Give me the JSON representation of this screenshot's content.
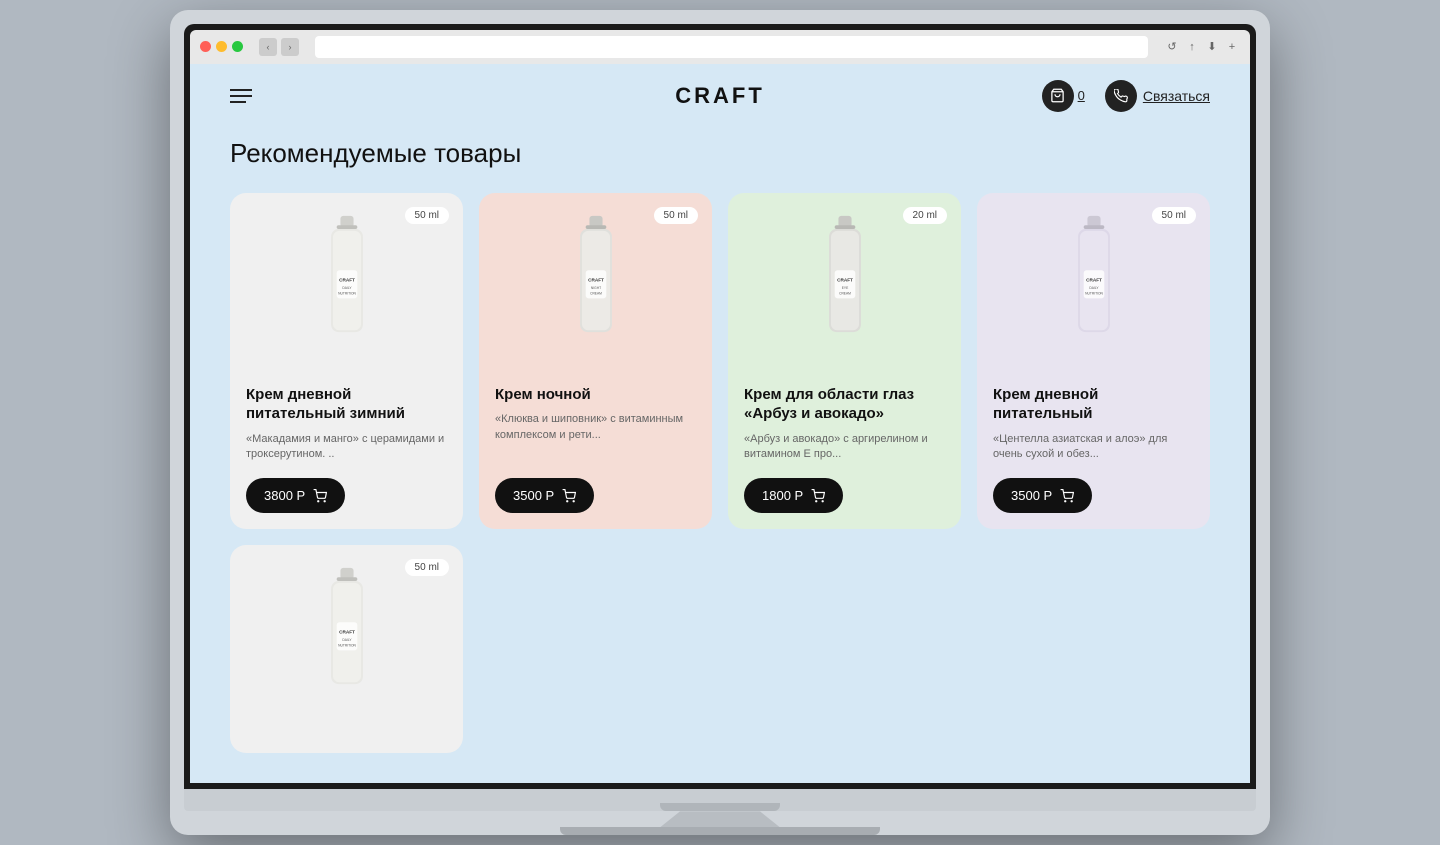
{
  "browser": {
    "nav_back": "‹",
    "nav_forward": "›",
    "reload_icon": "↺",
    "share_icon": "↑",
    "download_icon": "⬇",
    "new_tab_icon": "+"
  },
  "site": {
    "logo": "CRAFT",
    "menu_icon": "menu",
    "cart_count": "0",
    "contact_label": "Связаться",
    "page_title": "Рекомендуемые товары"
  },
  "products": [
    {
      "id": "p1",
      "volume": "50 ml",
      "name": "Крем дневной питательный зимний",
      "desc": "«Макадамия и манго» с церамидами и троксерутином. ..",
      "price": "3800 Р",
      "bg": "white",
      "craft_label": "CRAFT"
    },
    {
      "id": "p2",
      "volume": "50 ml",
      "name": "Крем ночной",
      "desc": "«Клюква и шиповник» с витаминным комплексом и рети...",
      "price": "3500 Р",
      "bg": "pink",
      "craft_label": "CRAFT"
    },
    {
      "id": "p3",
      "volume": "20 ml",
      "name": "Крем для области глаз «Арбуз и авокадо»",
      "desc": "«Арбуз и авокадо» с аргирелином и витамином Е про...",
      "price": "1800 Р",
      "bg": "green",
      "craft_label": "CRAFT"
    },
    {
      "id": "p4",
      "volume": "50 ml",
      "name": "Крем дневной питательный",
      "desc": "«Центелла азиатская и алоэ» для очень сухой и обез...",
      "price": "3500 Р",
      "bg": "lavender",
      "craft_label": "CRAFT"
    },
    {
      "id": "p5",
      "volume": "50 ml",
      "name": "",
      "desc": "",
      "price": "",
      "bg": "white",
      "craft_label": "CRAFT"
    }
  ]
}
